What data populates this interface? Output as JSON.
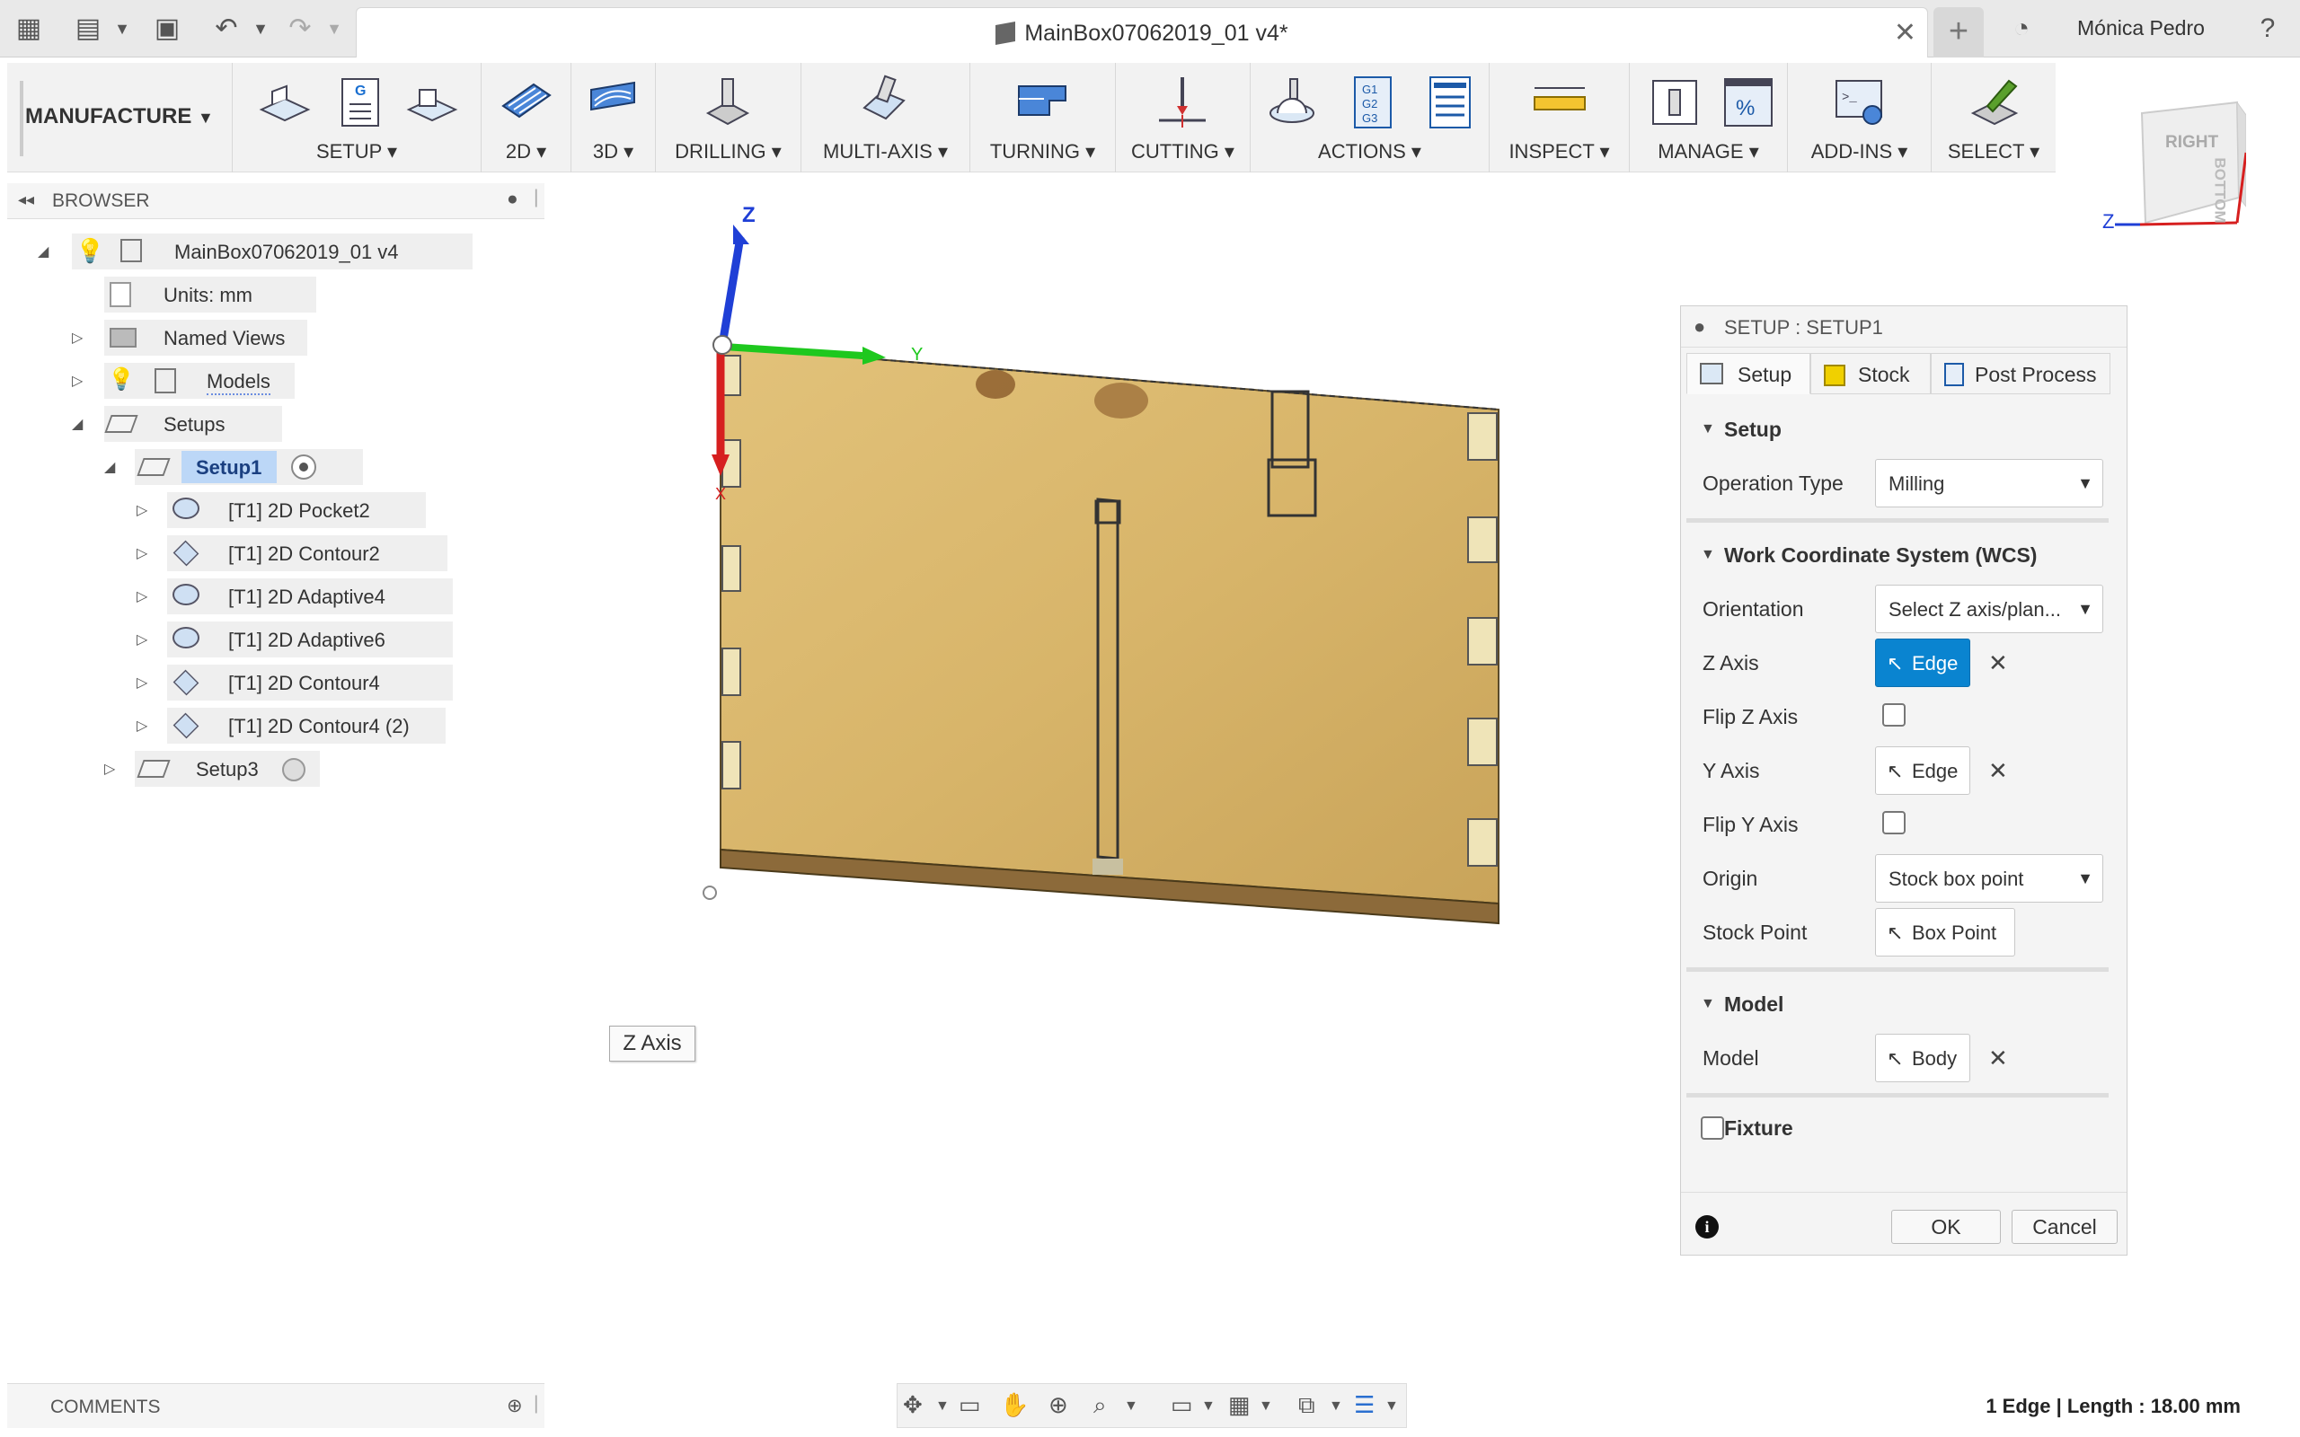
{
  "titlebar": {
    "doc_title": "MainBox07062019_01 v4*",
    "user": "Mónica Pedro"
  },
  "toolbar": {
    "workspace": "MANUFACTURE",
    "groups": [
      {
        "label": "SETUP"
      },
      {
        "label": "2D"
      },
      {
        "label": "3D"
      },
      {
        "label": "DRILLING"
      },
      {
        "label": "MULTI-AXIS"
      },
      {
        "label": "TURNING"
      },
      {
        "label": "CUTTING"
      },
      {
        "label": "ACTIONS"
      },
      {
        "label": "INSPECT"
      },
      {
        "label": "MANAGE"
      },
      {
        "label": "ADD-INS"
      },
      {
        "label": "SELECT"
      }
    ]
  },
  "browser": {
    "title": "BROWSER",
    "root": "MainBox07062019_01 v4",
    "units": "Units: mm",
    "named_views": "Named Views",
    "models": "Models",
    "setups": "Setups",
    "setup1": "Setup1",
    "ops": [
      "[T1] 2D Pocket2",
      "[T1] 2D Contour2",
      "[T1] 2D Adaptive4",
      "[T1] 2D Adaptive6",
      "[T1] 2D Contour4",
      "[T1] 2D Contour4 (2)"
    ],
    "setup3": "Setup3"
  },
  "viewport": {
    "axis_z": "Z",
    "axis_y": "Y",
    "axis_x": "X",
    "tooltip": "Z Axis",
    "viewcube_right": "RIGHT",
    "viewcube_bottom": "BOTTOM",
    "viewcube_z": "Z"
  },
  "panel": {
    "title": "SETUP : SETUP1",
    "tabs": [
      "Setup",
      "Stock",
      "Post Process"
    ],
    "setup_section": "Setup",
    "operation_type_label": "Operation Type",
    "operation_type_value": "Milling",
    "wcs_section": "Work Coordinate System (WCS)",
    "orientation_label": "Orientation",
    "orientation_value": "Select Z axis/plan...",
    "z_axis_label": "Z Axis",
    "z_axis_value": "Edge",
    "flip_z_label": "Flip Z Axis",
    "y_axis_label": "Y Axis",
    "y_axis_value": "Edge",
    "flip_y_label": "Flip Y Axis",
    "origin_label": "Origin",
    "origin_value": "Stock box point",
    "stock_point_label": "Stock Point",
    "stock_point_value": "Box Point",
    "model_section": "Model",
    "model_label": "Model",
    "model_value": "Body",
    "fixture_label": "Fixture",
    "ok": "OK",
    "cancel": "Cancel"
  },
  "comments": "COMMENTS",
  "status": "1 Edge | Length : 18.00 mm",
  "colors": {
    "accent": "#0a84d0",
    "wood": "#d8b56a",
    "axis_x": "#d61f1f",
    "axis_y": "#1ec81e",
    "axis_z": "#1f3fd6"
  }
}
